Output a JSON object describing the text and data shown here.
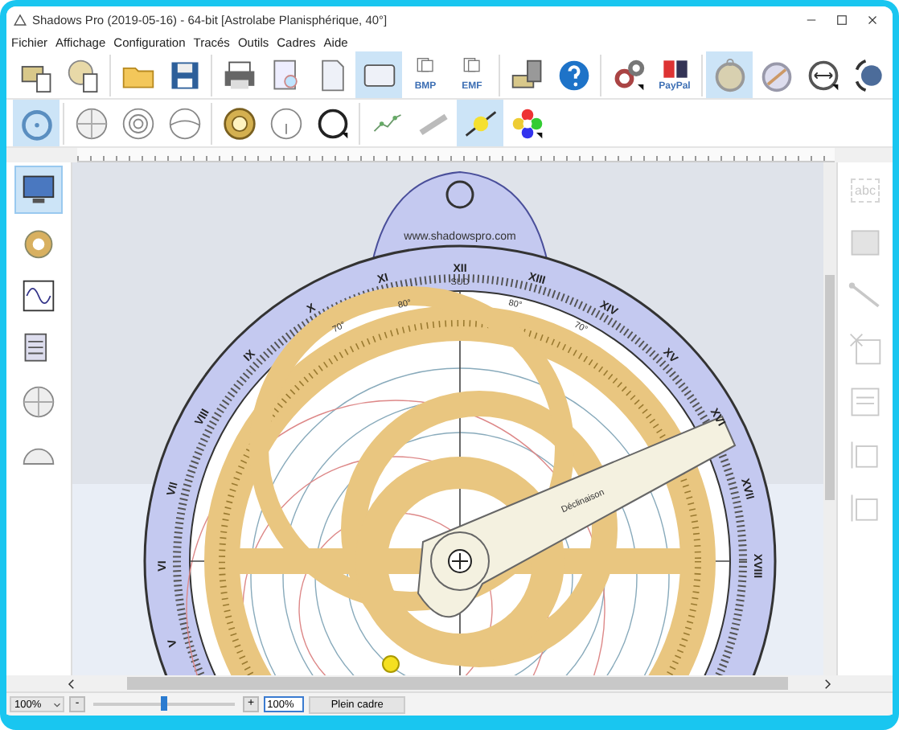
{
  "window": {
    "title": "Shadows Pro (2019-05-16) - 64-bit [Astrolabe Planisphérique, 40°]"
  },
  "menu": [
    "Fichier",
    "Affichage",
    "Configuration",
    "Tracés",
    "Outils",
    "Cadres",
    "Aide"
  ],
  "toolbar_1": [
    {
      "selected": false
    },
    {
      "selected": false
    },
    {
      "selected": false
    },
    {
      "selected": false
    },
    {
      "selected": false
    },
    {
      "selected": false
    },
    {
      "selected": false
    },
    {
      "selected": true
    },
    {
      "selected": false,
      "label": "BMP"
    },
    {
      "selected": false,
      "label": "EMF"
    },
    {
      "selected": false
    },
    {
      "selected": false
    },
    {
      "selected": false
    },
    {
      "selected": false,
      "label": "PayPal"
    },
    {
      "selected": true
    },
    {
      "selected": false
    },
    {
      "selected": false
    },
    {
      "selected": false
    }
  ],
  "toolbar_2": [
    {
      "selected": true
    },
    {
      "selected": false
    },
    {
      "selected": false
    },
    {
      "selected": false
    },
    {
      "selected": false
    },
    {
      "selected": false
    },
    {
      "selected": false
    },
    {
      "selected": false
    },
    {
      "selected": false
    },
    {
      "selected": true
    },
    {
      "selected": false
    }
  ],
  "left_sidebar": [
    {
      "selected": true
    },
    {
      "selected": false
    },
    {
      "selected": false
    },
    {
      "selected": false
    },
    {
      "selected": false
    },
    {
      "selected": false
    }
  ],
  "right_sidebar": [
    {
      "disabled": true,
      "label": "abc"
    },
    {
      "disabled": true
    },
    {
      "disabled": true
    },
    {
      "disabled": true
    },
    {
      "disabled": true
    },
    {
      "disabled": true
    },
    {
      "disabled": true
    }
  ],
  "astrolabe": {
    "website": "www.shadowspro.com",
    "south_label": "SUD",
    "hours": [
      "XII",
      "XIII",
      "XIV",
      "XV",
      "XVI",
      "XVII",
      "XVIII",
      "XI",
      "X",
      "IX",
      "VIII",
      "VII",
      "VI",
      "V"
    ],
    "degrees": [
      "80°",
      "70°",
      "80°",
      "70°"
    ],
    "rule_label": "Déclinaison"
  },
  "status_bar": {
    "zoom_select": "100%",
    "minus_button": "-",
    "zoom_slider": {
      "level": 0.5
    },
    "plus_button": "+",
    "zoom_field": "100%",
    "fit_button": "Plein cadre"
  }
}
